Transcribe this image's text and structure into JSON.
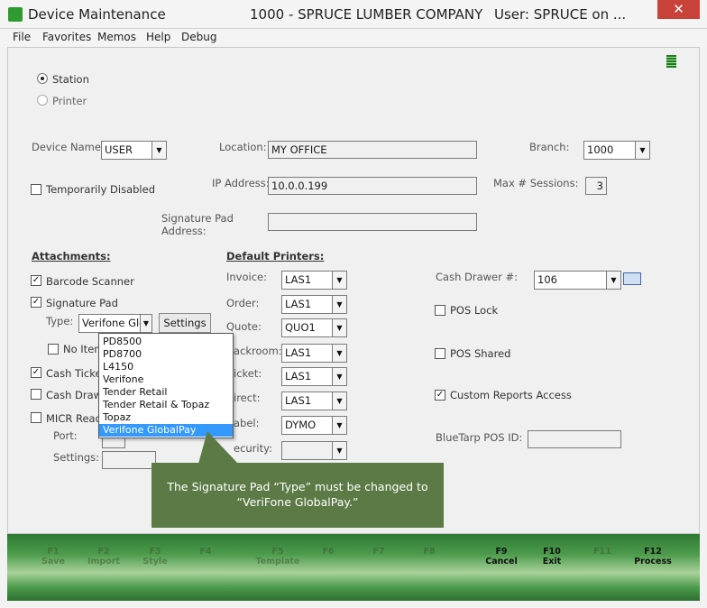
{
  "window": {
    "title": "Device Maintenance",
    "company": "1000 - SPRUCE LUMBER COMPANY",
    "user": "User: SPRUCE on ...",
    "close_label": "✕",
    "app_icon": "green-app-icon"
  },
  "menu": [
    "File",
    "Favorites",
    "Memos",
    "Help",
    "Debug"
  ],
  "device_type": {
    "options": [
      {
        "label": "Station",
        "selected": true
      },
      {
        "label": "Printer",
        "selected": false
      }
    ]
  },
  "device": {
    "name_label": "Device Name:",
    "name_value": "USER",
    "location_label": "Location:",
    "location_value": "MY OFFICE",
    "branch_label": "Branch:",
    "branch_value": "1000",
    "temp_disabled_label": "Temporarily Disabled",
    "ip_label": "IP Address:",
    "ip_value": "10.0.0.199",
    "max_sessions_label": "Max # Sessions:",
    "max_sessions_value": "3",
    "sigpad_address_label_1": "Signature Pad",
    "sigpad_address_label_2": "Address:",
    "sigpad_address_value": ""
  },
  "attachments": {
    "heading": "Attachments:",
    "barcode_label": "Barcode Scanner",
    "sigpad_label": "Signature Pad",
    "type_label": "Type:",
    "type_value": "Verifone Glob",
    "settings_button": "Settings",
    "no_item_label": "No Item",
    "cash_ticket_label": "Cash Ticke",
    "cash_drawer_label": "Cash Drawe",
    "micr_label": "MICR Read",
    "port_label": "Port:",
    "settings_label": "Settings:"
  },
  "type_dropdown": {
    "items": [
      "PD8500",
      "PD8700",
      "L4150",
      "Verifone",
      "Tender Retail",
      "Tender Retail & Topaz",
      "Topaz",
      "Verifone GlobalPay"
    ],
    "selected_index": 7
  },
  "printers": {
    "heading": "Default Printers:",
    "rows": [
      {
        "label": "Invoice:",
        "value": "LAS1"
      },
      {
        "label": "Order:",
        "value": "LAS1"
      },
      {
        "label": "Quote:",
        "value": "QUO1"
      },
      {
        "label": "ackroom:",
        "value": "LAS1"
      },
      {
        "label": "icket:",
        "value": "LAS1"
      },
      {
        "label": "irect:",
        "value": "LAS1"
      },
      {
        "label": "abel:",
        "value": "DYMO"
      },
      {
        "label": "ecurity:",
        "value": ""
      }
    ]
  },
  "right_panel": {
    "cash_drawer_label": "Cash Drawer #:",
    "cash_drawer_value": "106",
    "pos_lock_label": "POS Lock",
    "pos_shared_label": "POS Shared",
    "custom_reports_label": "Custom Reports Access",
    "bluetarp_label": "BlueTarp POS ID:",
    "bluetarp_value": ""
  },
  "callout": {
    "line1": "The Signature Pad “Type” must be changed to",
    "line2": "“VeriFone GlobalPay.”",
    "color": "#5b7a45"
  },
  "fkeys": [
    {
      "key": "F1",
      "label": "Save",
      "active": false
    },
    {
      "key": "F2",
      "label": "Import",
      "active": false
    },
    {
      "key": "F3",
      "label": "Style",
      "active": false
    },
    {
      "key": "F4",
      "label": "",
      "active": false
    },
    {
      "key": "F5",
      "label": "Template",
      "active": false
    },
    {
      "key": "F6",
      "label": "",
      "active": false
    },
    {
      "key": "F7",
      "label": "",
      "active": false
    },
    {
      "key": "F8",
      "label": "",
      "active": false
    },
    {
      "key": "F9",
      "label": "Cancel",
      "active": true
    },
    {
      "key": "F10",
      "label": "Exit",
      "active": true
    },
    {
      "key": "F11",
      "label": "",
      "active": false
    },
    {
      "key": "F12",
      "label": "Process",
      "active": true
    }
  ]
}
